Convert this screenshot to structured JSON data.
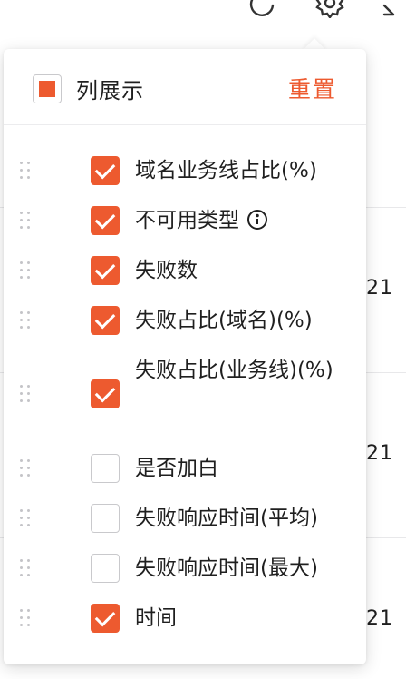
{
  "toolbar": {
    "icons": [
      "refresh-icon",
      "gear-icon",
      "expand-icon"
    ]
  },
  "background": {
    "cells": [
      "21",
      "21",
      "21"
    ]
  },
  "column_panel": {
    "title": "列展示",
    "reset_label": "重置",
    "master_state": "indeterminate",
    "accent_color": "#ed5a2f",
    "items": [
      {
        "label": "域名业务线占比(%)",
        "checked": true
      },
      {
        "label": "不可用类型",
        "checked": true,
        "has_info": true
      },
      {
        "label": "失败数",
        "checked": true
      },
      {
        "label": "失败占比(域名)(%)",
        "checked": true
      },
      {
        "label": "失败占比(业务线)(%)",
        "checked": true
      },
      {
        "label": "是否加白",
        "checked": false
      },
      {
        "label": "失败响应时间(平均)",
        "checked": false
      },
      {
        "label": "失败响应时间(最大)",
        "checked": false
      },
      {
        "label": "时间",
        "checked": true
      }
    ]
  }
}
